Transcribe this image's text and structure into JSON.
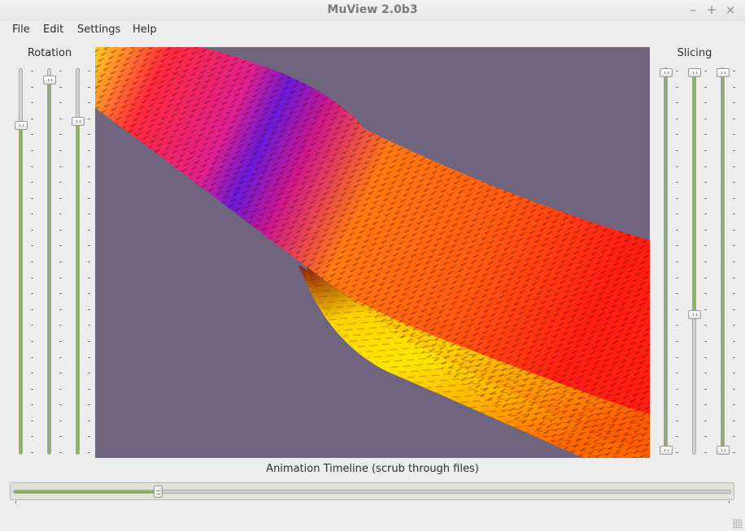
{
  "window": {
    "title": "MuView 2.0b3",
    "controls": [
      "minimize-icon",
      "maximize-icon",
      "close-icon"
    ],
    "control_glyphs": [
      "–",
      "+",
      "×"
    ]
  },
  "menu": [
    "File",
    "Edit",
    "Settings",
    "Help"
  ],
  "rotation": {
    "label": "Rotation",
    "sliders": [
      {
        "name": "rotation-x-slider",
        "value": 0.86
      },
      {
        "name": "rotation-y-slider",
        "value": 0.98
      },
      {
        "name": "rotation-z-slider",
        "value": 0.87
      }
    ]
  },
  "slicing": {
    "label": "Slicing",
    "sliders": [
      {
        "name": "slice-x-max-slider",
        "value": 1.0
      },
      {
        "name": "slice-y-max-slider",
        "value": 1.0
      },
      {
        "name": "slice-y-min-slider",
        "value": 0.36
      },
      {
        "name": "slice-z-max-slider",
        "value": 1.0
      },
      {
        "name": "slice-min-sliders",
        "value": 0.0
      }
    ]
  },
  "timeline": {
    "label": "Animation Timeline (scrub through files)",
    "value": 0.2
  },
  "colors": {
    "viewport_bg": "#70657e",
    "accent": "#8ab05e"
  }
}
